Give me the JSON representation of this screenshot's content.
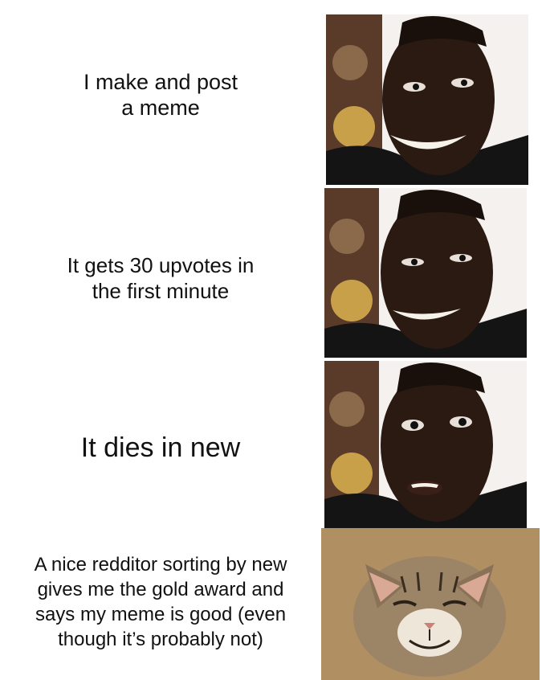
{
  "meme": {
    "panels": [
      {
        "caption_lines": [
          "I make and post",
          "a meme"
        ],
        "image": "happy-man-smiling-photo"
      },
      {
        "caption_lines": [
          "It gets 30 upvotes in",
          "the first minute"
        ],
        "image": "man-smiling-less-photo"
      },
      {
        "caption_lines": [
          "It dies in new"
        ],
        "image": "disappointed-man-photo"
      },
      {
        "caption_lines": [
          "A nice redditor sorting by new",
          "gives me the gold award and",
          "says my meme is good (even",
          "though it’s probably not)"
        ],
        "image": "smiling-kitten-photo"
      }
    ]
  }
}
